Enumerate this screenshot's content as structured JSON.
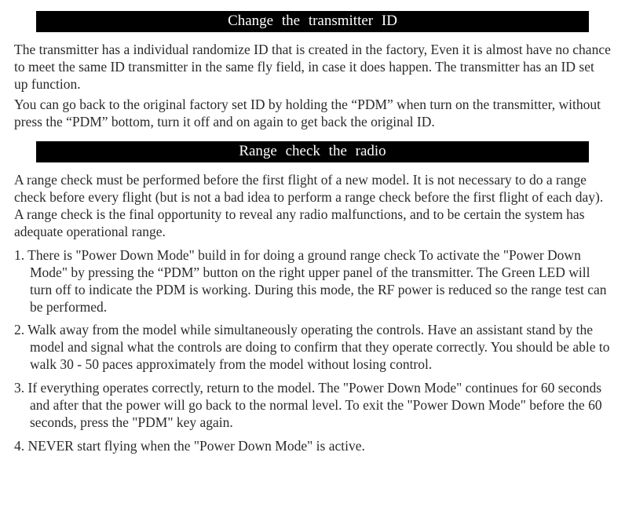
{
  "section1": {
    "title": "Change  the  transmitter   ID",
    "p1": "The transmitter has a individual randomize ID that is created in the factory, Even it is almost have no chance to meet the same ID transmitter in the same fly field, in case it does happen. The transmitter has an ID set up function.",
    "p2": "You can go back to the original factory set ID by holding the “PDM” when turn on the transmitter, without press the “PDM” bottom, turn it off and on  again to get back the original ID."
  },
  "section2": {
    "title": "Range  check  the  radio",
    "intro": "A range check must be performed before the first flight of a new model. It is not necessary to do a range check before every flight (but is not a bad idea to perform a range check before the first flight of each day). A range check is the final opportunity to reveal any radio malfunctions, and to be certain the system has adequate operational range.",
    "items": [
      "1. There is \"Power Down Mode\" build in for doing a ground range check To activate the \"Power Down Mode\" by pressing the “PDM” button  on the right upper panel of the transmitter. The Green LED will turn off to indicate the PDM is working. During this mode, the RF power is reduced so the range test can be performed.",
      "2. Walk away from the model while simultaneously operating the controls. Have an assistant stand by the model and signal what the controls are doing to confirm that they operate correctly. You should be able to walk  30 - 50 paces approximately from the model without losing control.",
      "3. If everything operates correctly, return to the model. The \"Power Down Mode\" continues for 60 seconds and after that the power will go back to the normal level. To exit the \"Power Down Mode\" before the 60 seconds, press the \"PDM\" key again.",
      "4. NEVER start flying when the \"Power Down Mode\" is active."
    ]
  }
}
